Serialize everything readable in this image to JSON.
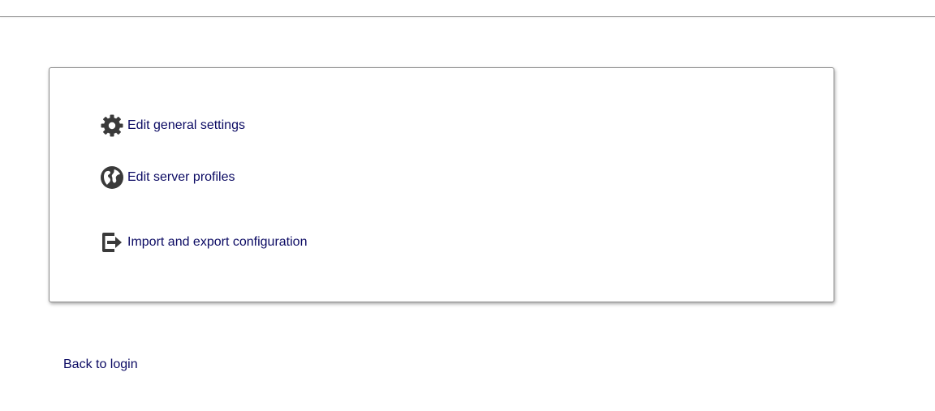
{
  "menu": {
    "items": [
      {
        "label": "Edit general settings",
        "icon": "gear-icon"
      },
      {
        "label": "Edit server profiles",
        "icon": "globe-icon"
      },
      {
        "label": "Import and export configuration",
        "icon": "exit-icon"
      }
    ]
  },
  "footer": {
    "back_label": "Back to login"
  },
  "colors": {
    "link": "#0b0a63",
    "icon": "#3a3a3a",
    "panel_border": "#8c8c8c",
    "divider": "#9a9a9a"
  }
}
